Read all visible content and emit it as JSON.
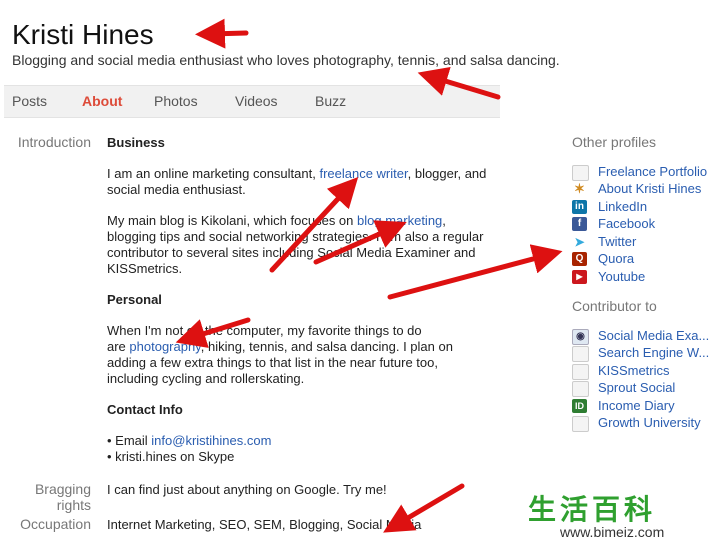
{
  "profile": {
    "name": "Kristi Hines",
    "tagline": "Blogging and social media enthusiast who loves photography, tennis, and salsa dancing."
  },
  "tabs": [
    {
      "label": "Posts"
    },
    {
      "label": "About",
      "active": true
    },
    {
      "label": "Photos"
    },
    {
      "label": "Videos"
    },
    {
      "label": "Buzz"
    }
  ],
  "intro": {
    "label": "Introduction",
    "business_heading": "Business",
    "business_p1_a": "I am an online marketing consultant, ",
    "business_p1_link": "freelance writer",
    "business_p1_b": ", blogger, and",
    "business_p1_c": "social media enthusiast.",
    "business_p2_a": "My main blog is Kikolani, which focuses on ",
    "business_p2_link": "blog marketing",
    "business_p2_b": ",",
    "business_p2_c": "blogging tips and social networking strategies. I am also a regular",
    "business_p2_d": "contributor to several sites including Social Media Examiner and",
    "business_p2_e": "KISSmetrics.",
    "personal_heading": "Personal",
    "personal_p1": "When I'm not on the computer, my favorite things to do",
    "personal_p2_a": "are ",
    "personal_p2_link": "photography",
    "personal_p2_b": ", hiking, tennis, and salsa dancing.  I plan on",
    "personal_p3": "adding a few extra things to that list in the near future too,",
    "personal_p4": "including cycling and rollerskating.",
    "contact_heading": "Contact Info",
    "contact_email_prefix": "• Email ",
    "contact_email": "info@kristihines.com",
    "contact_skype": "• kristi.hines on Skype"
  },
  "bragging": {
    "label_1": "Bragging",
    "label_2": "rights",
    "value": "I can find just about anything on Google. Try me!"
  },
  "occupation": {
    "label": "Occupation",
    "value": "Internet Marketing, SEO, SEM, Blogging, Social Media"
  },
  "sidebar": {
    "other_profiles_heading": "Other profiles",
    "other_profiles": [
      {
        "label": "Freelance Portfolio",
        "icon": "page-icon"
      },
      {
        "label": "About Kristi Hines",
        "icon": "butterfly-icon"
      },
      {
        "label": "LinkedIn",
        "icon": "linkedin-icon"
      },
      {
        "label": "Facebook",
        "icon": "facebook-icon"
      },
      {
        "label": "Twitter",
        "icon": "twitter-icon"
      },
      {
        "label": "Quora",
        "icon": "quora-icon"
      },
      {
        "label": "Youtube",
        "icon": "youtube-icon"
      }
    ],
    "contributor_heading": "Contributor to",
    "contributor_to": [
      {
        "label": "Social Media Exa...",
        "icon": "sme-icon"
      },
      {
        "label": "Search Engine W...",
        "icon": "page-icon"
      },
      {
        "label": "KISSmetrics",
        "icon": "page-icon"
      },
      {
        "label": "Sprout Social",
        "icon": "page-icon"
      },
      {
        "label": "Income Diary",
        "icon": "id-icon"
      },
      {
        "label": "Growth University",
        "icon": "page-icon"
      }
    ]
  },
  "watermark": {
    "chinese": "生活百科",
    "url": "www.bimeiz.com"
  },
  "colors": {
    "link": "#2a5db0",
    "active_tab": "#dd4b39",
    "arrow": "#dd1111",
    "watermark": "#2fa02f"
  }
}
